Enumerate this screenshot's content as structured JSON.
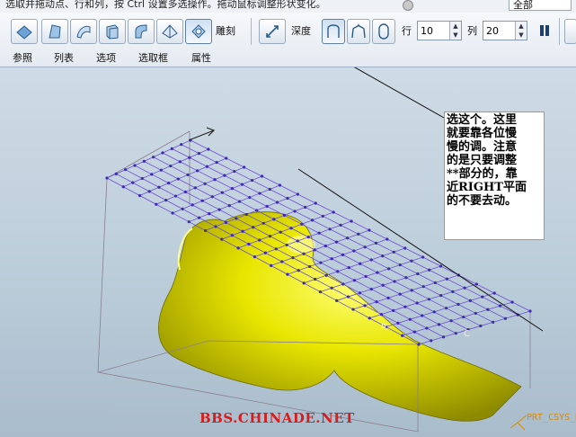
{
  "top_strip": {
    "message": "选取并拖动点、行和列，按 Ctrl 设置多选操作。拖动鼠标调整形状变化。",
    "dropdown_value": "全部"
  },
  "toolbar": {
    "carve_label": "雕刻",
    "depth_label": "深度",
    "row_label": "行",
    "row_value": "10",
    "col_label": "列",
    "col_value": "20",
    "tabs": [
      "参照",
      "列表",
      "选项",
      "选取框",
      "属性"
    ]
  },
  "annotation": {
    "text": "选这个。这里\n就要靠各位慢\n慢的调。注意\n的是只要调整\n**部分的，靠\n近RIGHT平面\n的不要去动。"
  },
  "viewport": {
    "marker_r": "R",
    "marker_c": "C",
    "csys_label": "PRT_CSYS_DEF",
    "watermark": "BBS.CHINADE.NET",
    "colors": {
      "model": "#e6e600",
      "grid": "#6b4fd8",
      "background": "#c3d3e0"
    }
  }
}
